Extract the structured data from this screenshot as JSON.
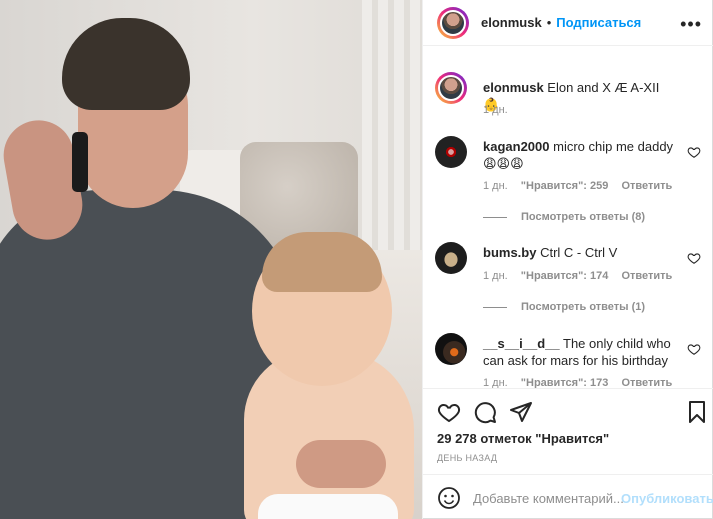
{
  "header": {
    "username": "elonmusk",
    "separator": "•",
    "follow_label": "Подписаться",
    "more_label": "•••"
  },
  "caption": {
    "username": "elonmusk",
    "text": " Elon and X Æ A-XII 👶",
    "time": "1 дн."
  },
  "comments": [
    {
      "username": "kagan2000",
      "text": " micro chip me daddy",
      "emoji": "😩😩😩",
      "time": "1 дн.",
      "likes": "\"Нравится\": 259",
      "reply_label": "Ответить",
      "replies_label": "Посмотреть ответы (8)"
    },
    {
      "username": "bums.by",
      "text": " Ctrl C - Ctrl V",
      "time": "1 дн.",
      "likes": "\"Нравится\": 174",
      "reply_label": "Ответить",
      "replies_label": "Посмотреть ответы (1)"
    },
    {
      "username": "__s__i__d__",
      "text": " The only child who can ask for mars for his birthday",
      "time": "1 дн.",
      "likes": "\"Нравится\": 173",
      "reply_label": "Ответить"
    }
  ],
  "actions": {
    "likes_text": "29 278 отметок \"Нравится\"",
    "date_text": "ДЕНЬ НАЗАД"
  },
  "add_comment": {
    "placeholder": "Добавьте комментарий...",
    "post_label": "Опубликовать"
  },
  "icons": [
    "heart-icon",
    "comment-icon",
    "share-icon",
    "bookmark-icon",
    "emoji-icon",
    "more-icon"
  ]
}
